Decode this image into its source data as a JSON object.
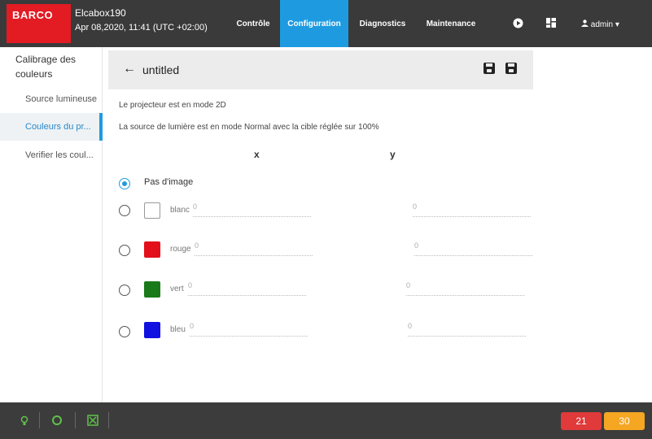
{
  "header": {
    "logo": "BARCO",
    "device_name": "Elcabox190",
    "device_datetime": "Apr 08,2020, 11:41 (UTC +02:00)",
    "tabs": [
      {
        "label": "Contrôle",
        "active": false
      },
      {
        "label": "Configuration",
        "active": true
      },
      {
        "label": "Diagnostics",
        "active": false
      },
      {
        "label": "Maintenance",
        "active": false
      }
    ],
    "user": "admin",
    "icons": [
      "play-circle-icon",
      "dashboard-icon",
      "person-icon",
      "caret-down-icon"
    ]
  },
  "sidebar": {
    "title": "Calibrage des couleurs",
    "items": [
      {
        "label": "Source lumineuse",
        "active": false
      },
      {
        "label": "Couleurs du pr...",
        "active": true
      },
      {
        "label": "Verifier les coul...",
        "active": false
      }
    ]
  },
  "content": {
    "title": "untitled",
    "info_line1": "Le projecteur est en mode 2D",
    "info_line2": "La source de lumière est en mode Normal avec la cible réglée sur 100%",
    "col_x": "x",
    "col_y": "y",
    "no_image_label": "Pas d'image",
    "rows": [
      {
        "label": "blanc",
        "color": "#ffffff",
        "x": "0",
        "y": "0"
      },
      {
        "label": "rouge",
        "color": "#e3101b",
        "x": "0",
        "y": "0"
      },
      {
        "label": "vert",
        "color": "#1a7a1a",
        "x": "0",
        "y": "0"
      },
      {
        "label": "bleu",
        "color": "#1010e0",
        "x": "0",
        "y": "0"
      }
    ]
  },
  "footer": {
    "badge_red": "21",
    "badge_orange": "30",
    "colors": {
      "green": "#5fc24a",
      "red": "#e03a3a",
      "orange": "#f5a623"
    }
  }
}
